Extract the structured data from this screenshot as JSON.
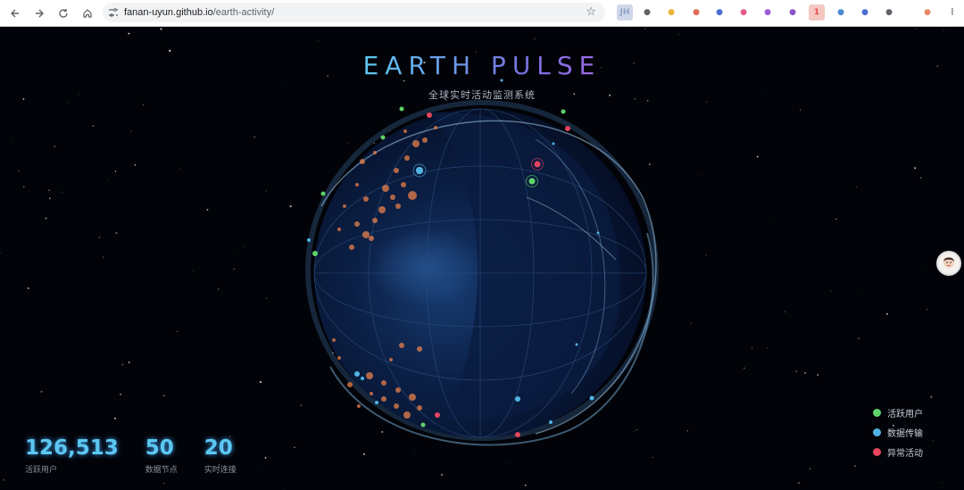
{
  "browser": {
    "url_host": "fanan-uyun.github.io",
    "url_path": "/earth-activity/",
    "extensions": [
      {
        "icon": "ext-jh-icon",
        "text": "JH",
        "color": "#8fa3c7"
      },
      {
        "icon": "ext-elephant-icon",
        "text": "",
        "color": "#5f6368"
      },
      {
        "icon": "ext-download-icon",
        "text": "",
        "color": "#e9b33a"
      },
      {
        "icon": "ext-pen-icon",
        "text": "",
        "color": "#e06a55"
      },
      {
        "icon": "ext-scissors-icon",
        "text": "",
        "color": "#4a6fd1"
      },
      {
        "icon": "ext-translate-icon",
        "text": "",
        "color": "#e85a8a"
      },
      {
        "icon": "ext-brain-icon",
        "text": "",
        "color": "#a05bd6"
      },
      {
        "icon": "ext-flag-icon",
        "text": "",
        "color": "#8a55c9"
      },
      {
        "icon": "ext-badge-icon",
        "text": "1",
        "color": "#e94b4b"
      },
      {
        "icon": "ext-bucket-icon",
        "text": "",
        "color": "#4a8ad1"
      },
      {
        "icon": "ext-pencil-icon",
        "text": "",
        "color": "#4a6fd1"
      },
      {
        "icon": "ext-puzzle-icon",
        "text": "",
        "color": "#5f6368"
      },
      {
        "icon": "profile-avatar-icon",
        "text": "",
        "color": "#e9896a"
      },
      {
        "icon": "menu-icon",
        "text": "",
        "color": "#5f6368"
      }
    ]
  },
  "header": {
    "title": "EARTH PULSE",
    "subtitle": "全球实时活动监测系统"
  },
  "stats": [
    {
      "value": "126,513",
      "label": "活跃用户"
    },
    {
      "value": "50",
      "label": "数据节点"
    },
    {
      "value": "20",
      "label": "实时连接"
    }
  ],
  "legend": [
    {
      "label": "活跃用户",
      "color": "#5fd36a"
    },
    {
      "label": "数据传输",
      "color": "#4fb4e4"
    },
    {
      "label": "异常活动",
      "color": "#e4455f"
    }
  ],
  "colors": {
    "accent": "#5cc8f2",
    "globe": "#0b1a3a",
    "activity": "#e8804a"
  }
}
